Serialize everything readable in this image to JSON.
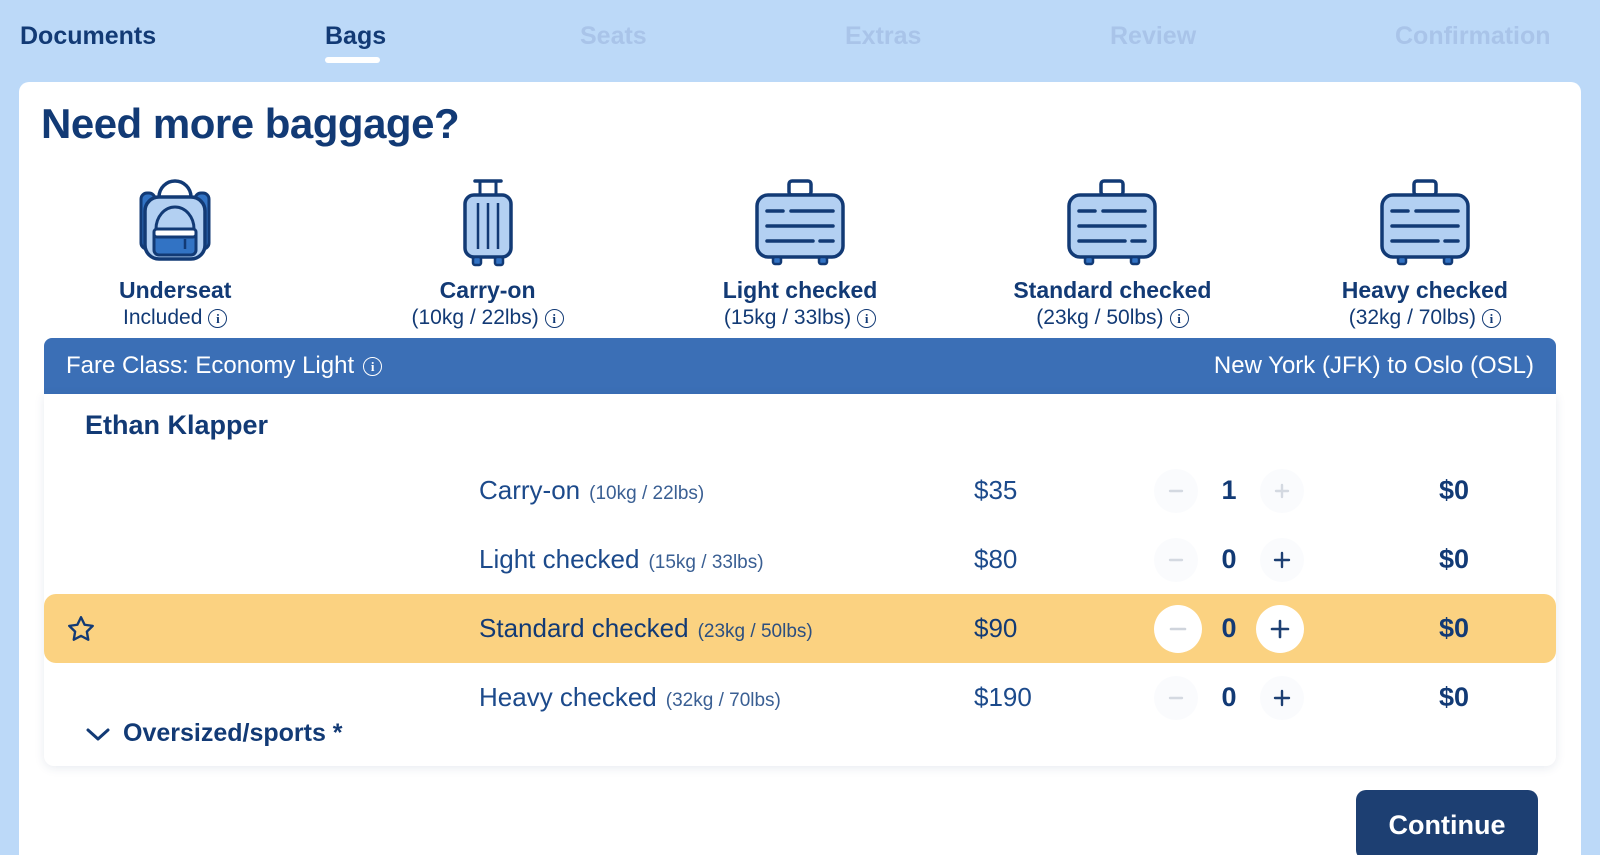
{
  "colors": {
    "page_bg": "#bcd9f8",
    "navy": "#123a75",
    "link_blue": "#1c4a8b",
    "fare_bar": "#3b6fb6",
    "highlight": "#fbd281",
    "button": "#1d3f72",
    "muted_step": "#a9c4e9"
  },
  "stepnav": {
    "steps": [
      {
        "label": "Documents",
        "state": "done"
      },
      {
        "label": "Bags",
        "state": "active"
      },
      {
        "label": "Seats",
        "state": "upcoming"
      },
      {
        "label": "Extras",
        "state": "upcoming"
      },
      {
        "label": "Review",
        "state": "upcoming"
      },
      {
        "label": "Confirmation",
        "state": "upcoming"
      }
    ]
  },
  "main": {
    "title": "Need more baggage?",
    "bag_types": [
      {
        "icon": "backpack-icon",
        "name": "Underseat",
        "sub": "Included",
        "has_info": true
      },
      {
        "icon": "carryon-suitcase-icon",
        "name": "Carry-on",
        "sub": "(10kg / 22lbs)",
        "has_info": true
      },
      {
        "icon": "checked-suitcase-icon",
        "name": "Light checked",
        "sub": "(15kg / 33lbs)",
        "has_info": true
      },
      {
        "icon": "checked-suitcase-icon",
        "name": "Standard checked",
        "sub": "(23kg / 50lbs)",
        "has_info": true
      },
      {
        "icon": "checked-suitcase-icon",
        "name": "Heavy checked",
        "sub": "(32kg / 70lbs)",
        "has_info": true
      }
    ]
  },
  "fare_bar": {
    "fare_label": "Fare Class: Economy Light",
    "info_icon": "info-icon",
    "route": "New York (JFK) to Oslo (OSL)"
  },
  "passenger": {
    "name": "Ethan Klapper",
    "rows": [
      {
        "label": "Carry-on",
        "weight": "(10kg / 22lbs)",
        "price": "$35",
        "qty": "1",
        "total": "$0",
        "highlighted": false,
        "starred": false,
        "minus_enabled": false,
        "plus_enabled": false
      },
      {
        "label": "Light checked",
        "weight": "(15kg / 33lbs)",
        "price": "$80",
        "qty": "0",
        "total": "$0",
        "highlighted": false,
        "starred": false,
        "minus_enabled": false,
        "plus_enabled": true
      },
      {
        "label": "Standard checked",
        "weight": "(23kg / 50lbs)",
        "price": "$90",
        "qty": "0",
        "total": "$0",
        "highlighted": true,
        "starred": true,
        "minus_enabled": false,
        "plus_enabled": true
      },
      {
        "label": "Heavy checked",
        "weight": "(32kg / 70lbs)",
        "price": "$190",
        "qty": "0",
        "total": "$0",
        "highlighted": false,
        "starred": false,
        "minus_enabled": false,
        "plus_enabled": true
      }
    ],
    "oversized_label": "Oversized/sports *",
    "oversized_chevron": "chevron-down-icon"
  },
  "footer": {
    "continue_label": "Continue"
  }
}
